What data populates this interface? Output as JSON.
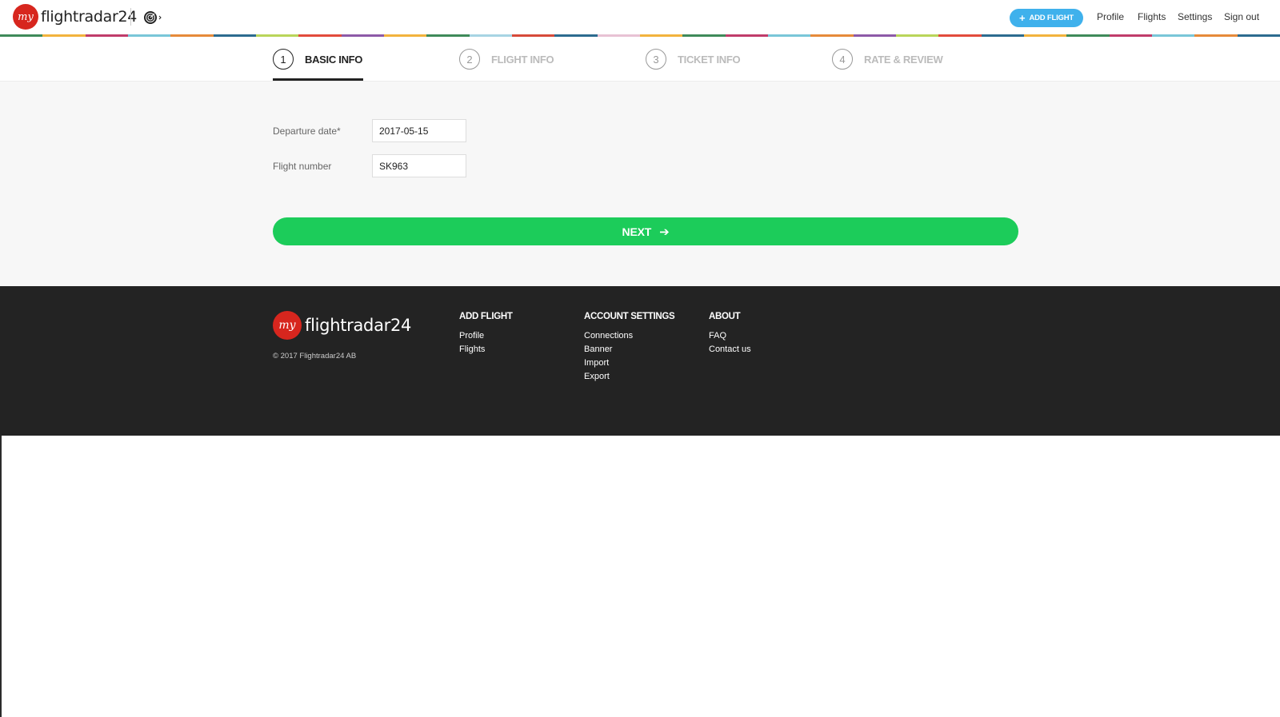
{
  "header": {
    "logo_badge": "my",
    "logo_text": "flightradar24",
    "radar_icon": "radar-icon",
    "add_flight_label": "ADD FLIGHT",
    "add_flight_icon": "plus-icon",
    "nav": [
      {
        "label": "Profile"
      },
      {
        "label": "Flights"
      },
      {
        "label": "Settings"
      },
      {
        "label": "Sign out"
      }
    ]
  },
  "colors": {
    "add_flight": "#3fb1ec",
    "next_button": "#1ccc5a",
    "footer_bg": "#232323",
    "logo_red": "#d7261e"
  },
  "steps": [
    {
      "number": "1",
      "label": "BASIC INFO",
      "active": true
    },
    {
      "number": "2",
      "label": "FLIGHT INFO",
      "active": false
    },
    {
      "number": "3",
      "label": "TICKET INFO",
      "active": false
    },
    {
      "number": "4",
      "label": "RATE & REVIEW",
      "active": false
    }
  ],
  "form": {
    "departure_date_label": "Departure date*",
    "departure_date_value": "2017-05-15",
    "flight_number_label": "Flight number",
    "flight_number_value": "SK963",
    "next_label": "NEXT",
    "next_icon": "arrow-right-icon"
  },
  "footer": {
    "logo_badge": "my",
    "logo_text": "flightradar24",
    "copyright": "© 2017 Flightradar24 AB",
    "columns": [
      {
        "title": "ADD FLIGHT",
        "links": [
          "Profile",
          "Flights"
        ]
      },
      {
        "title": "ACCOUNT SETTINGS",
        "links": [
          "Connections",
          "Banner",
          "Import",
          "Export"
        ]
      },
      {
        "title": "ABOUT",
        "links": [
          "FAQ",
          "Contact us"
        ]
      }
    ]
  }
}
